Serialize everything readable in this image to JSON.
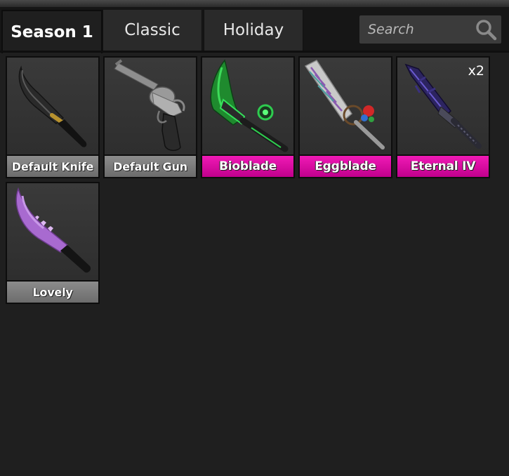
{
  "tabs": [
    {
      "label": "Season 1",
      "active": true
    },
    {
      "label": "Classic",
      "active": false
    },
    {
      "label": "Holiday",
      "active": false
    }
  ],
  "search": {
    "placeholder": "Search",
    "icon": "search-icon"
  },
  "items": [
    {
      "name": "Default Knife",
      "rarity": "common",
      "count": ""
    },
    {
      "name": "Default Gun",
      "rarity": "common",
      "count": ""
    },
    {
      "name": "Bioblade",
      "rarity": "godly",
      "count": ""
    },
    {
      "name": "Eggblade",
      "rarity": "godly",
      "count": ""
    },
    {
      "name": "Eternal IV",
      "rarity": "godly",
      "count": "x2"
    },
    {
      "name": "Lovely",
      "rarity": "common",
      "count": ""
    }
  ],
  "colors": {
    "godly": "#e20ea8",
    "common": "#7a7a7a",
    "background": "#1f1f1f"
  }
}
